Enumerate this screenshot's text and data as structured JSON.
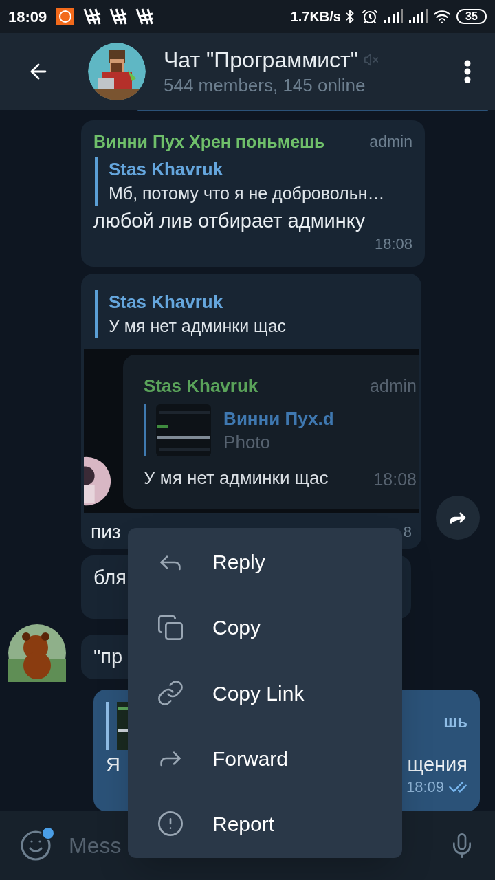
{
  "status_bar": {
    "time": "18:09",
    "speed": "1.7KB/s",
    "battery": "35"
  },
  "header": {
    "title": "Чат \"Программист\"",
    "subtitle": "544 members, 145 online",
    "muted": true
  },
  "messages": [
    {
      "kind": "sliver"
    },
    {
      "kind": "reply_text",
      "sender": "Винни Пух Хрен поньмешь",
      "badge": "admin",
      "reply": {
        "author": "Stas Khavruk",
        "text": "Мб, потому что я не добровольн…"
      },
      "text": "любой лив отбирает админку",
      "time": "18:08"
    },
    {
      "kind": "reply_screenshot",
      "reply": {
        "author": "Stas Khavruk",
        "text": "У мя нет админки щас"
      },
      "screenshot": {
        "sender": "Stas Khavruk",
        "badge": "admin",
        "reply_author": "Винни Пух.d",
        "reply_text": "Photo",
        "text": "У мя нет админки щас",
        "time": "18:08"
      },
      "text": "пиз",
      "time": "8"
    },
    {
      "kind": "plain",
      "text": "бля",
      "show_avatar": false
    },
    {
      "kind": "plain",
      "text": "\"пр",
      "show_avatar": true
    },
    {
      "kind": "outgoing_reply",
      "reply_author": "шь",
      "text_start": "Я",
      "text_end": "щения",
      "time": "18:09",
      "read": true
    }
  ],
  "input": {
    "placeholder": "Mess",
    "sticker_badge": true
  },
  "context_menu": {
    "items": [
      {
        "kind": "reply",
        "label": "Reply"
      },
      {
        "kind": "copy",
        "label": "Copy"
      },
      {
        "kind": "link",
        "label": "Copy Link"
      },
      {
        "kind": "forward",
        "label": "Forward"
      },
      {
        "kind": "report",
        "label": "Report"
      }
    ]
  }
}
